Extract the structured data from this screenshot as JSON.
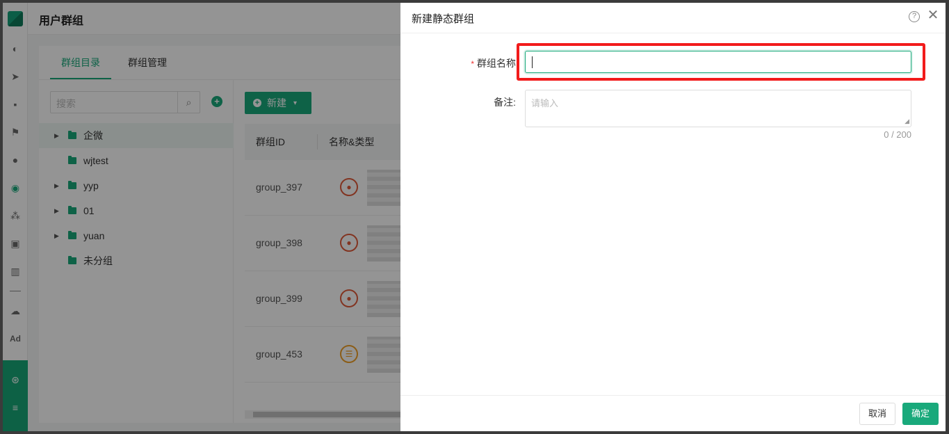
{
  "page": {
    "title": "用户群组"
  },
  "sidebar": {
    "icons": [
      "dashboard-icon",
      "send-icon",
      "blurred-icon",
      "flag-icon",
      "user-icon",
      "user-group-icon",
      "cluster-icon",
      "bookmark-icon",
      "bar-chart-icon",
      "wechat-icon",
      "ad-icon",
      "hub-icon",
      "menu-icon"
    ],
    "ad_label": "Ad"
  },
  "tabs": [
    {
      "label": "群组目录",
      "active": true
    },
    {
      "label": "群组管理",
      "active": false
    }
  ],
  "tree": {
    "search_placeholder": "搜索",
    "add_symbol": "+",
    "items": [
      {
        "label": "企微",
        "expandable": true,
        "selected": true
      },
      {
        "label": "wjtest",
        "expandable": false,
        "selected": false
      },
      {
        "label": "yyp",
        "expandable": true,
        "selected": false
      },
      {
        "label": "01",
        "expandable": true,
        "selected": false
      },
      {
        "label": "yuan",
        "expandable": true,
        "selected": false
      },
      {
        "label": "未分组",
        "expandable": false,
        "selected": false
      }
    ]
  },
  "toolbar": {
    "new_label": "新建"
  },
  "table": {
    "columns": [
      "群组ID",
      "名称&类型"
    ],
    "rows": [
      {
        "id": "group_397",
        "type_icon": "user-circle-icon"
      },
      {
        "id": "group_398",
        "type_icon": "user-circle-icon"
      },
      {
        "id": "group_399",
        "type_icon": "user-circle-icon"
      },
      {
        "id": "group_453",
        "type_icon": "list-circle-icon"
      }
    ]
  },
  "drawer": {
    "title": "新建静态群组",
    "name_label": "群组名称",
    "required_mark": "*",
    "name_value": "",
    "remark_label": "备注:",
    "remark_placeholder": "请输入",
    "counter": "0 / 200",
    "cancel_label": "取消",
    "ok_label": "确定",
    "highlight_color": "#f21b1b"
  },
  "colors": {
    "accent": "#19a97b",
    "mask": "rgba(0,0,0,0.42)"
  }
}
